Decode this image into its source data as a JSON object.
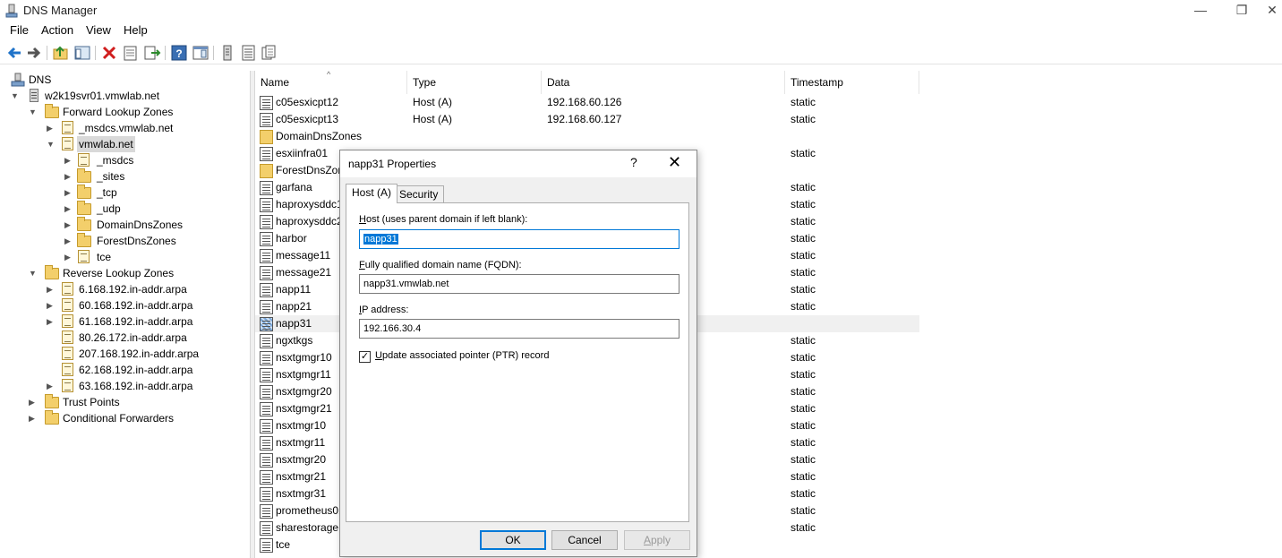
{
  "window": {
    "title": "DNS Manager",
    "minimize_glyph": "—",
    "restore_glyph": "❐",
    "close_glyph": "✕"
  },
  "menu": [
    "File",
    "Action",
    "View",
    "Help"
  ],
  "toolbar": {
    "icons": [
      "back-arrow-icon",
      "forward-arrow-icon",
      "up-folder-icon",
      "show-hide-tree-icon",
      "delete-icon",
      "properties-icon",
      "export-list-icon",
      "help-icon",
      "show-pane-icon",
      "server-icon",
      "list-icon",
      "copy-icon"
    ]
  },
  "tree": {
    "root": "DNS",
    "server": "w2k19svr01.vmwlab.net",
    "forward_zones": "Forward Lookup Zones",
    "forward_items": {
      "msdcs_zone": "_msdcs.vmwlab.net",
      "vmwlab": "vmwlab.net",
      "sub": [
        "_msdcs",
        "_sites",
        "_tcp",
        "_udp",
        "DomainDnsZones",
        "ForestDnsZones",
        "tce"
      ]
    },
    "reverse_zones": "Reverse Lookup Zones",
    "reverse_items": [
      "6.168.192.in-addr.arpa",
      "60.168.192.in-addr.arpa",
      "61.168.192.in-addr.arpa",
      "80.26.172.in-addr.arpa",
      "207.168.192.in-addr.arpa",
      "62.168.192.in-addr.arpa",
      "63.168.192.in-addr.arpa"
    ],
    "trust_points": "Trust Points",
    "conditional_forwarders": "Conditional Forwarders"
  },
  "list": {
    "columns": [
      "Name",
      "Type",
      "Data",
      "Timestamp"
    ],
    "rows": [
      {
        "name": "c05esxicpt12",
        "type": "Host (A)",
        "data": "192.168.60.126",
        "timestamp": "static"
      },
      {
        "name": "c05esxicpt13",
        "type": "Host (A)",
        "data": "192.168.60.127",
        "timestamp": "static"
      },
      {
        "name": "DomainDnsZones",
        "type": "",
        "data": "",
        "timestamp": ""
      },
      {
        "name": "esxiinfra01",
        "type": "",
        "data": "",
        "timestamp": "static"
      },
      {
        "name": "ForestDnsZon",
        "type": "",
        "data": "",
        "timestamp": ""
      },
      {
        "name": "garfana",
        "type": "",
        "data": "",
        "timestamp": "static"
      },
      {
        "name": "haproxysddc1",
        "type": "",
        "data": "",
        "timestamp": "static"
      },
      {
        "name": "haproxysddc2",
        "type": "",
        "data": "",
        "timestamp": "static"
      },
      {
        "name": "harbor",
        "type": "",
        "data": "",
        "timestamp": "static"
      },
      {
        "name": "message11",
        "type": "",
        "data": "",
        "timestamp": "static"
      },
      {
        "name": "message21",
        "type": "",
        "data": "",
        "timestamp": "static"
      },
      {
        "name": "napp11",
        "type": "",
        "data": "",
        "timestamp": "static"
      },
      {
        "name": "napp21",
        "type": "",
        "data": "",
        "timestamp": "static"
      },
      {
        "name": "napp31",
        "type": "",
        "data": "",
        "timestamp": ""
      },
      {
        "name": "ngxtkgs",
        "type": "",
        "data": "",
        "timestamp": "static"
      },
      {
        "name": "nsxtgmgr10",
        "type": "",
        "data": "",
        "timestamp": "static"
      },
      {
        "name": "nsxtgmgr11",
        "type": "",
        "data": "",
        "timestamp": "static"
      },
      {
        "name": "nsxtgmgr20",
        "type": "",
        "data": "",
        "timestamp": "static"
      },
      {
        "name": "nsxtgmgr21",
        "type": "",
        "data": "",
        "timestamp": "static"
      },
      {
        "name": "nsxtmgr10",
        "type": "",
        "data": "",
        "timestamp": "static"
      },
      {
        "name": "nsxtmgr11",
        "type": "",
        "data": "",
        "timestamp": "static"
      },
      {
        "name": "nsxtmgr20",
        "type": "",
        "data": "",
        "timestamp": "static"
      },
      {
        "name": "nsxtmgr21",
        "type": "",
        "data": "",
        "timestamp": "static"
      },
      {
        "name": "nsxtmgr31",
        "type": "",
        "data": "",
        "timestamp": "static"
      },
      {
        "name": "prometheus01",
        "type": "",
        "data": "",
        "timestamp": "static"
      },
      {
        "name": "sharestorage",
        "type": "",
        "data": "",
        "timestamp": "static"
      },
      {
        "name": "tce",
        "type": "",
        "data": "",
        "timestamp": ""
      }
    ]
  },
  "dialog": {
    "title": "napp31 Properties",
    "help": "?",
    "close": "✕",
    "tabs": [
      "Host (A)",
      "Security"
    ],
    "host_label_prefix": "H",
    "host_label_rest": "ost (uses parent domain if left blank):",
    "host_value": "napp31",
    "fqdn_label_prefix": "F",
    "fqdn_label_rest": "ully qualified domain name (FQDN):",
    "fqdn_value": "napp31.vmwlab.net",
    "ip_label_prefix": "I",
    "ip_label_rest": "P address:",
    "ip_value": "192.166.30.4",
    "ptr_checked": true,
    "ptr_check_glyph": "✓",
    "ptr_label_prefix": "U",
    "ptr_label_rest": "pdate associated pointer (PTR) record",
    "ok": "OK",
    "cancel": "Cancel",
    "apply_prefix": "A",
    "apply_rest": "pply"
  }
}
